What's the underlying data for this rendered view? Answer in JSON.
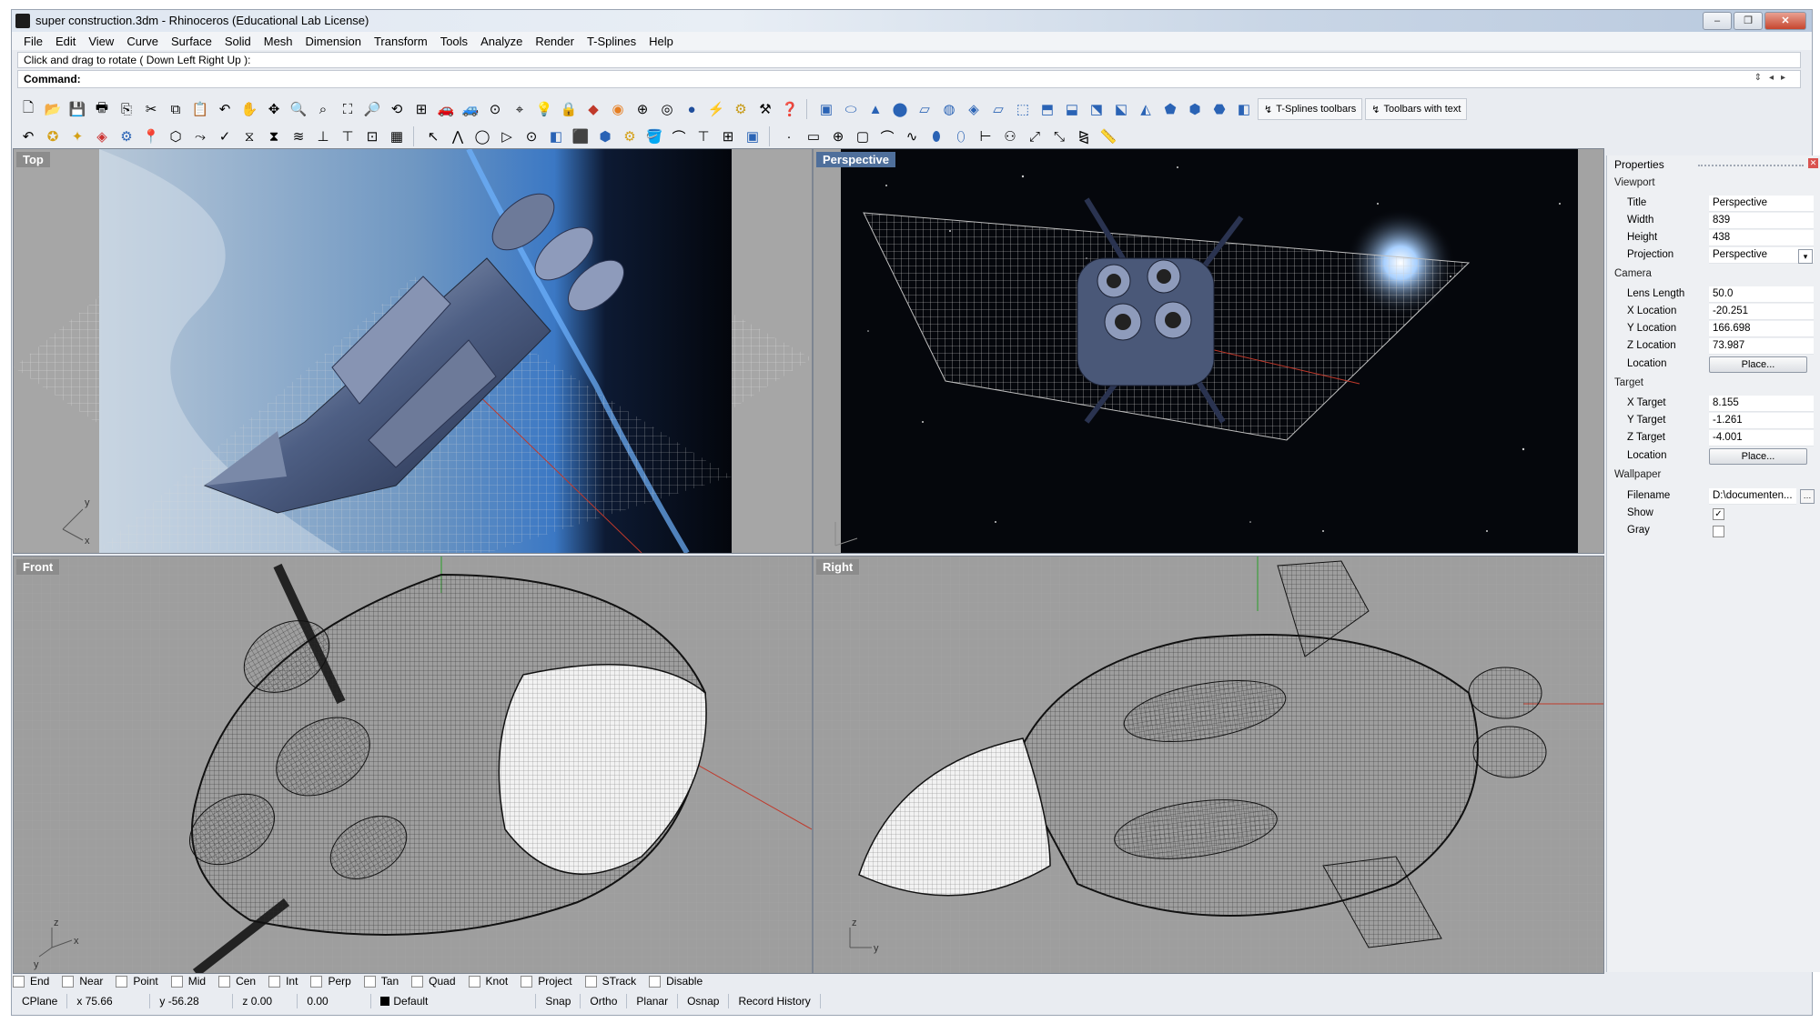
{
  "window": {
    "title": "super construction.3dm - Rhinoceros (Educational Lab License)",
    "buttons": [
      "–",
      "❐",
      "✕"
    ]
  },
  "menu": [
    "File",
    "Edit",
    "View",
    "Curve",
    "Surface",
    "Solid",
    "Mesh",
    "Dimension",
    "Transform",
    "Tools",
    "Analyze",
    "Render",
    "T-Splines",
    "Help"
  ],
  "command": {
    "history": "Click and drag to rotate ( Down  Left  Right  Up ):",
    "prompt_label": "Command:",
    "value": ""
  },
  "toolbar_text": {
    "tsplines": "T-Splines toolbars",
    "with_text": "Toolbars with text"
  },
  "viewports": {
    "top": "Top",
    "perspective": "Perspective",
    "front": "Front",
    "right": "Right"
  },
  "properties": {
    "title": "Properties",
    "sections": {
      "viewport": "Viewport",
      "camera": "Camera",
      "target": "Target",
      "wallpaper": "Wallpaper"
    },
    "viewport": {
      "title_label": "Title",
      "title": "Perspective",
      "width_label": "Width",
      "width": "839",
      "height_label": "Height",
      "height": "438",
      "projection_label": "Projection",
      "projection": "Perspective"
    },
    "camera": {
      "lens_label": "Lens Length",
      "lens": "50.0",
      "x_label": "X Location",
      "x": "-20.251",
      "y_label": "Y Location",
      "y": "166.698",
      "z_label": "Z Location",
      "z": "73.987",
      "location_label": "Location",
      "place": "Place..."
    },
    "target": {
      "x_label": "X Target",
      "x": "8.155",
      "y_label": "Y Target",
      "y": "-1.261",
      "z_label": "Z Target",
      "z": "-4.001",
      "location_label": "Location",
      "place": "Place..."
    },
    "wallpaper": {
      "filename_label": "Filename",
      "filename": "D:\\documenten...",
      "show_label": "Show",
      "show": true,
      "gray_label": "Gray",
      "gray": false
    }
  },
  "osnaps": [
    "End",
    "Near",
    "Point",
    "Mid",
    "Cen",
    "Int",
    "Perp",
    "Tan",
    "Quad",
    "Knot",
    "Project",
    "STrack",
    "Disable"
  ],
  "status": {
    "cplane": "CPlane",
    "x": "x 75.66",
    "y": "y -56.28",
    "z": "z 0.00",
    "extra": "0.00",
    "layer": "Default",
    "snap": "Snap",
    "ortho": "Ortho",
    "planar": "Planar",
    "osnap": "Osnap",
    "history": "Record History"
  },
  "axis_labels": {
    "x": "x",
    "y": "y",
    "z": "z"
  },
  "colors": {
    "active_viewport": "#4f6f9b",
    "space_bg": "#05070c",
    "earth_blue": "#3d78b8",
    "hull": "#5b6b8a"
  }
}
